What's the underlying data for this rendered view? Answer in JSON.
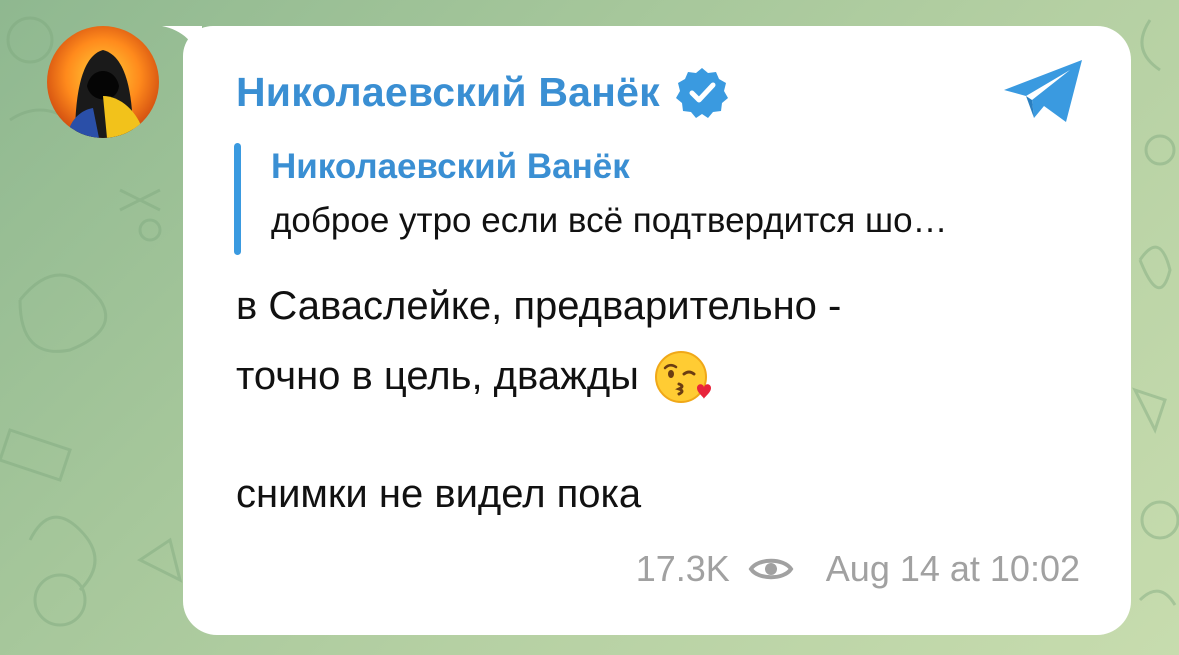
{
  "channel": {
    "name": "Николаевский Ванёк",
    "verified_icon": "verified-badge-icon",
    "share_icon": "telegram-share-icon",
    "accent_color": "#3a8fd3"
  },
  "reply": {
    "name": "Николаевский Ванёк",
    "text": "доброе утро если всё подтвердится шо…"
  },
  "message": {
    "line1": "в Саваслейке, предварительно -",
    "line2": "точно в цель, дважды",
    "emoji": "😘",
    "line3": "снимки не видел пока"
  },
  "meta": {
    "views": "17.3K",
    "views_icon": "eye-icon",
    "timestamp": "Aug 14 at 10:02"
  }
}
